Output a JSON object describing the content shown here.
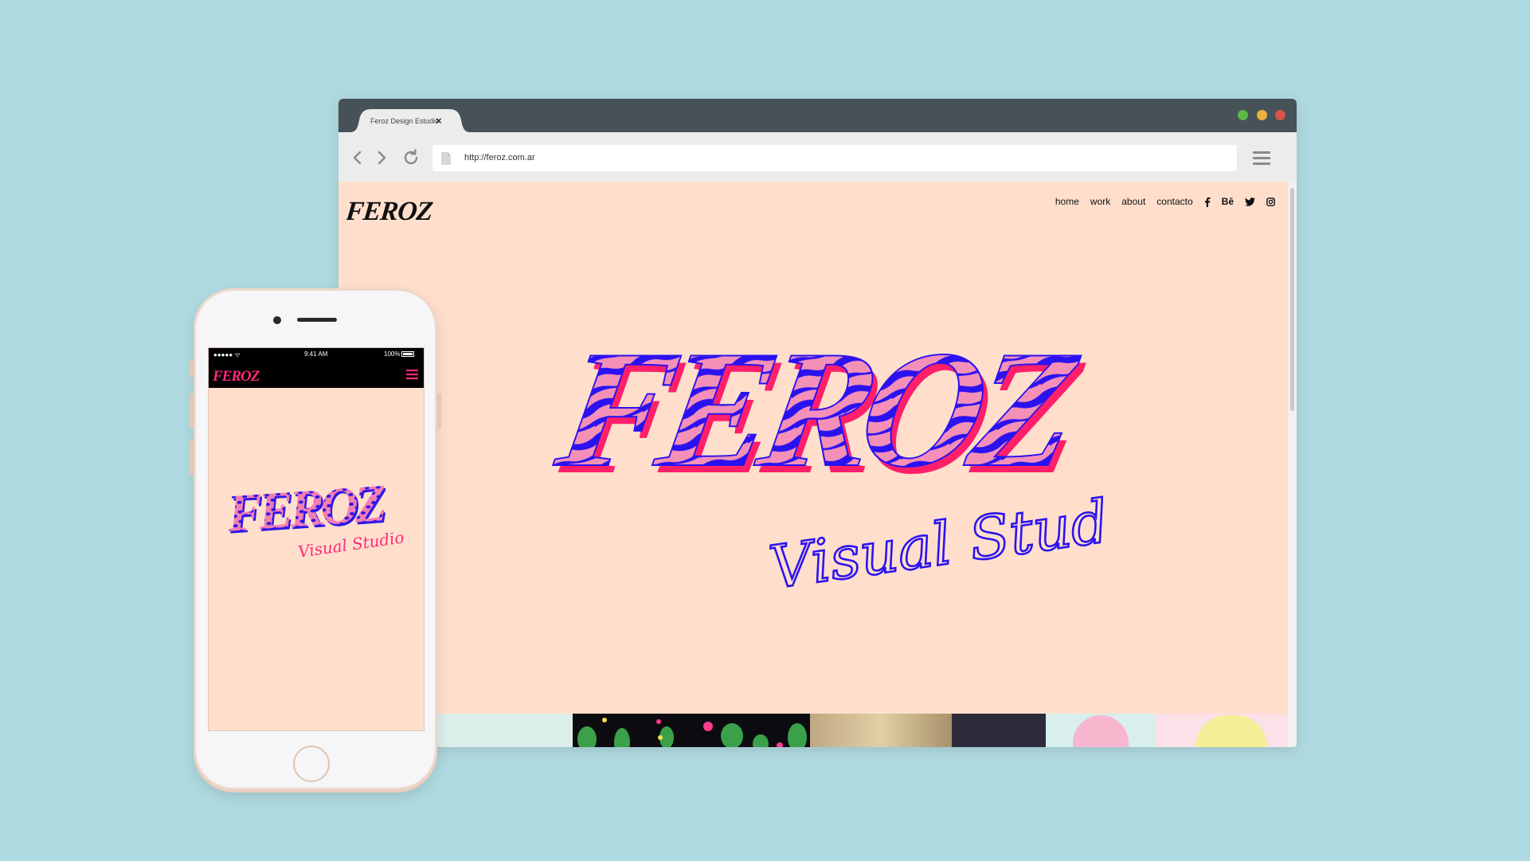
{
  "browser": {
    "tab_title": "Feroz Design Estudio",
    "tab_close": "×",
    "url": "http://feroz.com.ar"
  },
  "site": {
    "logo": "FEROZ",
    "nav": {
      "home": "home",
      "work": "work",
      "about": "about",
      "contacto": "contacto"
    },
    "social_behance": "Bē",
    "hero": {
      "title": "FEROZ",
      "subtitle": "Visual Studio"
    }
  },
  "phone": {
    "status": {
      "signal": "●●●●● ᯤ",
      "time": "9:41 AM",
      "battery": "100%"
    },
    "logo": "FEROZ",
    "hero_title": "FEROZ",
    "hero_subtitle": "Visual Studio"
  },
  "colors": {
    "background": "#b0dae1",
    "page_bg": "#ffdfcc",
    "hero_blue": "#2b12f0",
    "hero_pink": "#f490b8",
    "hero_red": "#ff1f6a"
  }
}
